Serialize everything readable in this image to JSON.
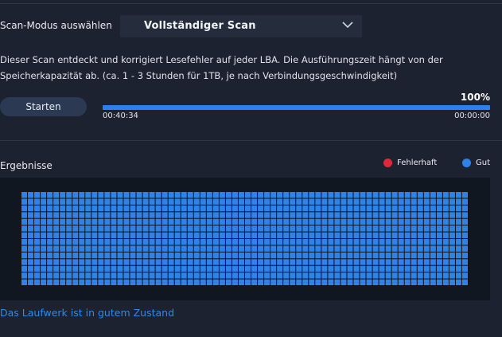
{
  "scan_mode": {
    "label": "Scan-Modus auswählen",
    "selected": "Vollständiger Scan"
  },
  "description": "Dieser Scan entdeckt und korrigiert Lesefehler auf jeder LBA. Die Ausführungszeit hängt von der Speicherkapazität ab. (ca. 1 - 3 Stunden für 1TB, je nach Verbindungsgeschwindigkeit)",
  "start_button": "Starten",
  "progress": {
    "percent_label": "100%",
    "percent_value": 100,
    "elapsed": "00:40:34",
    "remaining": "00:00:00"
  },
  "results": {
    "title": "Ergebnisse",
    "legend": {
      "faulty": "Fehlerhaft",
      "good": "Gut"
    },
    "grid_columns": 70,
    "grid_rows": 14,
    "faulty_blocks": 0
  },
  "colors": {
    "faulty": "#e0283a",
    "good": "#2f82e8",
    "accent": "#2d7ff0"
  },
  "status_message": "Das Laufwerk ist in gutem Zustand"
}
